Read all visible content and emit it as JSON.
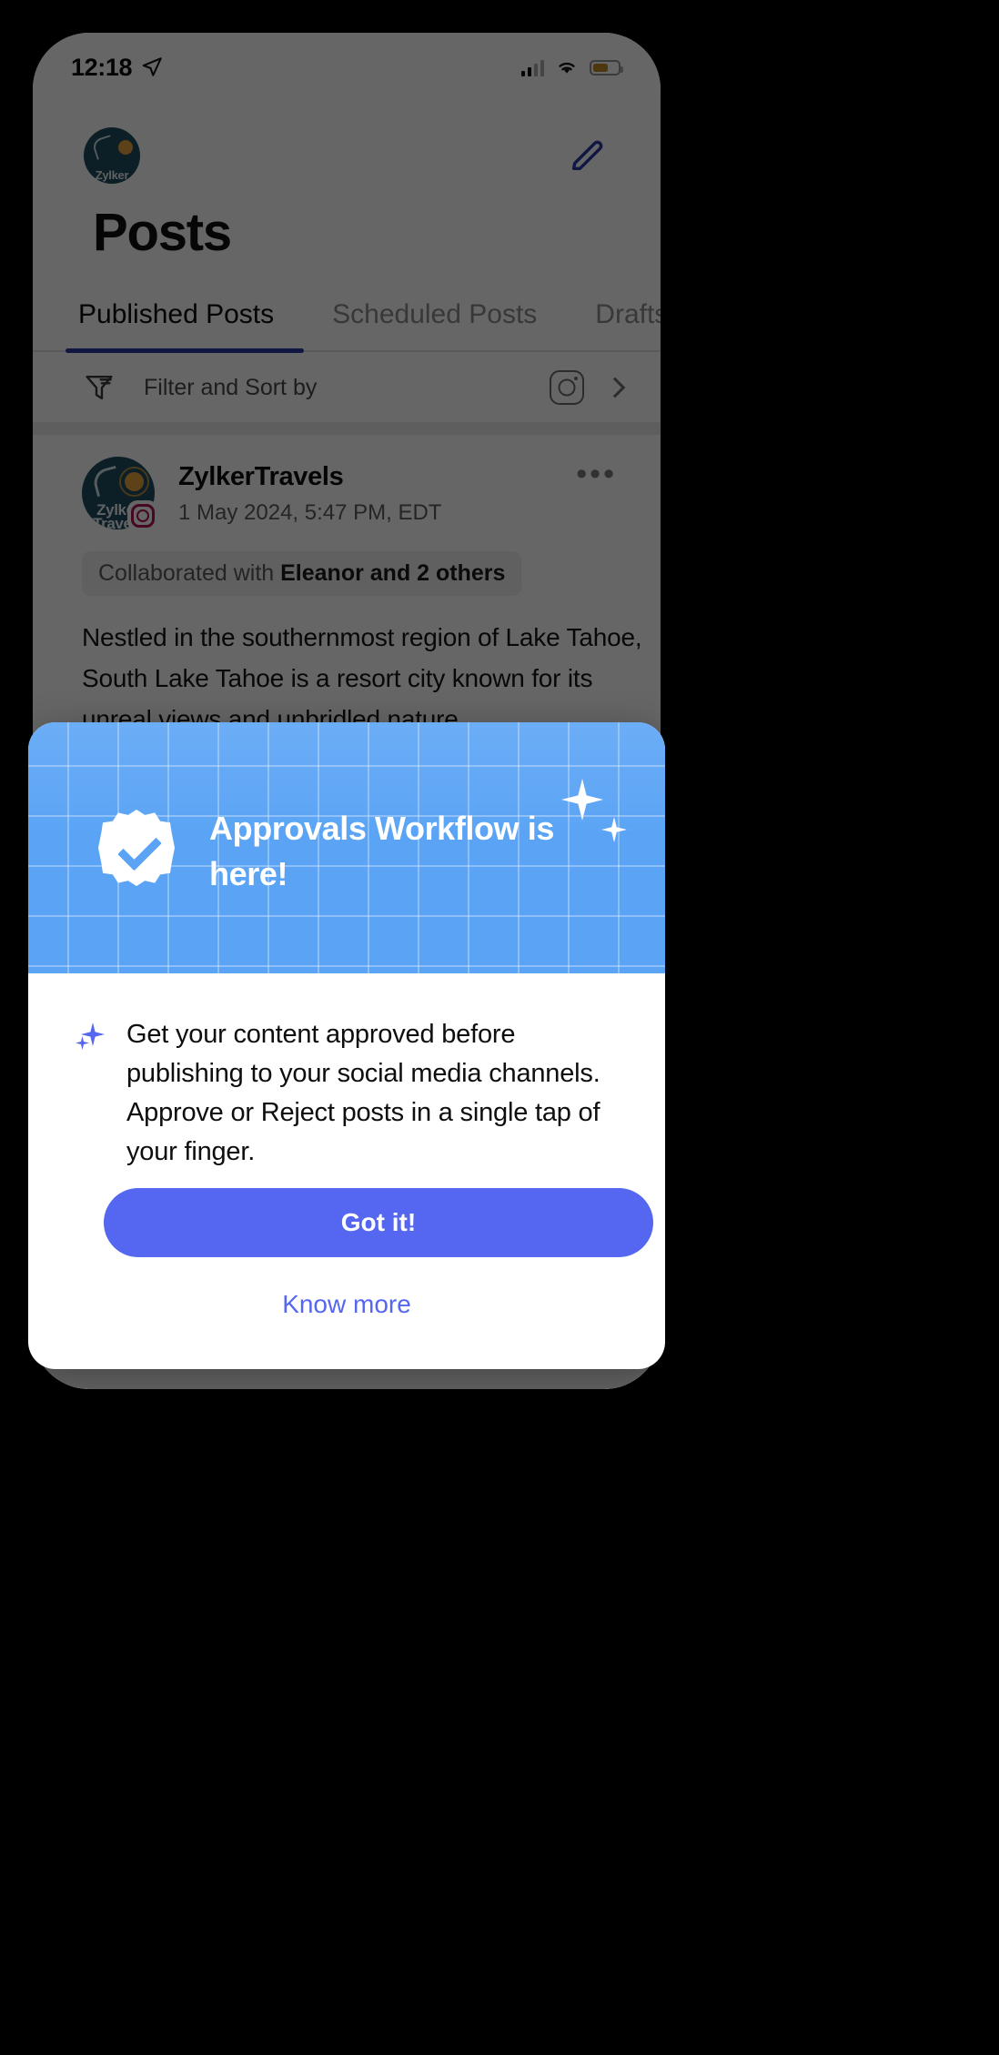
{
  "status_bar": {
    "time": "12:18",
    "location_icon": "location-arrow-icon",
    "signal_icon": "cellular-bars-icon",
    "wifi_icon": "wifi-icon",
    "battery_icon": "battery-icon"
  },
  "header": {
    "brand_logo_line1": "Zylker",
    "brand_logo_line2": "Travels",
    "page_title": "Posts",
    "compose_icon": "compose-pencil-icon"
  },
  "tabs": [
    {
      "label": "Published Posts",
      "active": true
    },
    {
      "label": "Scheduled Posts",
      "active": false
    },
    {
      "label": "Drafts",
      "active": false
    }
  ],
  "filter_bar": {
    "icon": "filter-funnel-icon",
    "label": "Filter and Sort by",
    "channel_icon": "instagram-icon",
    "chevron_icon": "chevron-right-icon"
  },
  "post": {
    "avatar_line1": "Zylker",
    "avatar_line2": "Travels",
    "network_badge": "instagram-badge-icon",
    "username": "ZylkerTravels",
    "timestamp": "1 May 2024, 5:47 PM, EDT",
    "more_icon": "more-options-icon",
    "collab_prefix": "Collaborated with ",
    "collab_names": "Eleanor and 2 others",
    "body": "Nestled in the southernmost region of Lake Tahoe, South Lake Tahoe is a resort city known for its unreal views and unbridled nature."
  },
  "modal": {
    "badge_icon": "verified-check-badge-icon",
    "sparkle_large_icon": "sparkle-icon",
    "sparkle_small_icon": "sparkle-icon",
    "title": "Approvals Workflow is here!",
    "bullet_icon": "sparkles-icon",
    "description": "Get your content approved before publishing to your social media channels. Approve or Reject posts in a single tap of your finger.",
    "primary_button": "Got it!",
    "secondary_button": "Know more"
  },
  "colors": {
    "header_blue": "#5BA4F5",
    "accent_indigo": "#5566F0",
    "tab_underline": "#2B3BA8",
    "avatar_teal": "#1E4B60",
    "instagram_pink": "#AE1358"
  }
}
